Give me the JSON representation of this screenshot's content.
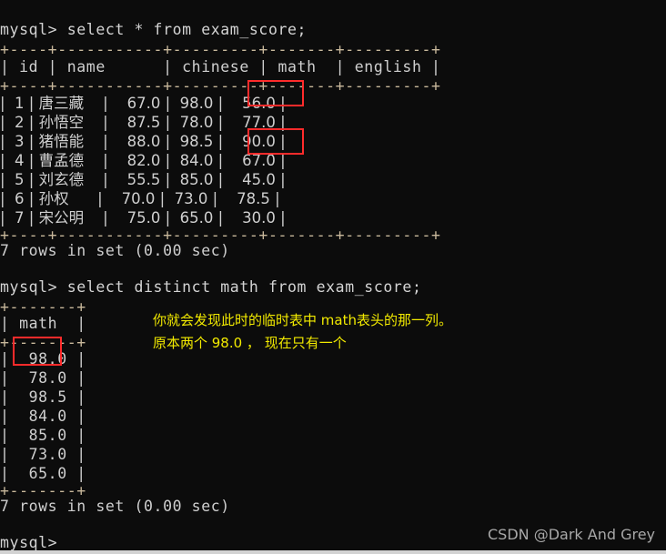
{
  "terminal": {
    "background": "#0c0c0c",
    "text_color": "#cfcfcf",
    "rule_color": "#c9b99c",
    "highlight_color": "#ff2b2b",
    "note_color": "#f2ea00",
    "prompt": "mysql>",
    "query1": "mysql> select * from exam_score;",
    "query1_rule_top": "+----+-----------+---------+-------+---------+",
    "query1_header": "| id | name      | chinese | math  | english |",
    "query1_rule_mid": "+----+-----------+---------+-------+---------+",
    "query1_rows": [
      "|  1 | 唐三藏    |    67.0 |  98.0 |    56.0 |",
      "|  2 | 孙悟空    |    87.5 |  78.0 |    77.0 |",
      "|  3 | 猪悟能    |    88.0 |  98.5 |    90.0 |",
      "|  4 | 曹孟德    |    82.0 |  84.0 |    67.0 |",
      "|  5 | 刘玄德    |    55.5 |  85.0 |    45.0 |",
      "|  6 | 孙权      |    70.0 |  73.0 |    78.5 |",
      "|  7 | 宋公明    |    75.0 |  65.0 |    30.0 |"
    ],
    "query1_rule_bottom": "+----+-----------+---------+-------+---------+",
    "query1_status": "7 rows in set (0.00 sec)",
    "query2": "mysql> select distinct math from exam_score;",
    "query2_rule_top": "+-------+",
    "query2_header": "| math  |",
    "query2_rule_mid": "+-------+",
    "query2_rows": [
      "|  98.0 |",
      "|  78.0 |",
      "|  98.5 |",
      "|  84.0 |",
      "|  85.0 |",
      "|  73.0 |",
      "|  65.0 |"
    ],
    "query2_rule_bottom": "+-------+",
    "query2_status": "7 rows in set (0.00 sec)",
    "final_prompt": "mysql>"
  },
  "table1": {
    "columns": [
      "id",
      "name",
      "chinese",
      "math",
      "english"
    ],
    "rows": [
      {
        "id": "1",
        "name": "唐三藏",
        "chinese": "67.0",
        "math": "98.0",
        "english": "56.0"
      },
      {
        "id": "2",
        "name": "孙悟空",
        "chinese": "87.5",
        "math": "78.0",
        "english": "77.0"
      },
      {
        "id": "3",
        "name": "猪悟能",
        "chinese": "88.0",
        "math": "98.5",
        "english": "90.0"
      },
      {
        "id": "4",
        "name": "曹孟德",
        "chinese": "82.0",
        "math": "84.0",
        "english": "67.0"
      },
      {
        "id": "5",
        "name": "刘玄德",
        "chinese": "55.5",
        "math": "85.0",
        "english": "45.0"
      },
      {
        "id": "6",
        "name": "孙权",
        "chinese": "70.0",
        "math": "73.0",
        "english": "78.5"
      },
      {
        "id": "7",
        "name": "宋公明",
        "chinese": "75.0",
        "math": "65.0",
        "english": "30.0"
      }
    ],
    "row_count_text": "7 rows in set (0.00 sec)"
  },
  "table2": {
    "columns": [
      "math"
    ],
    "values": [
      "98.0",
      "78.0",
      "98.5",
      "84.0",
      "85.0",
      "73.0",
      "65.0"
    ],
    "row_count_text": "7 rows in set (0.00 sec)"
  },
  "annotation": {
    "line1": "你就会发现此时的临时表中 math表头的那一列。",
    "line2": "原本两个 98.0 ， 现在只有一个"
  },
  "watermark": {
    "text": "CSDN @Dark And Grey"
  }
}
